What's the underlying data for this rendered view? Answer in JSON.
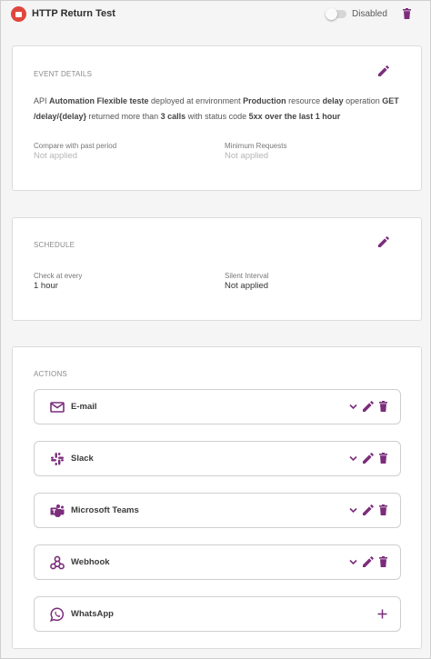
{
  "header": {
    "title": "HTTP Return Test",
    "toggle_label": "Disabled"
  },
  "event_details": {
    "section_title": "EVENT DETAILS",
    "desc": {
      "p1": "API ",
      "api_name": "Automation Flexible teste",
      "p2": " deployed at environment ",
      "environment": "Production",
      "p3": " resource ",
      "resource": "delay",
      "p4": " operation ",
      "operation": "GET /delay/{delay}",
      "p5": " returned more than ",
      "calls": "3 calls",
      "p6": " with status code ",
      "status_window": "5xx over the last 1 hour"
    },
    "compare_label": "Compare with past period",
    "compare_value": "Not applied",
    "min_requests_label": "Minimum Requests",
    "min_requests_value": "Not applied"
  },
  "schedule": {
    "section_title": "SCHEDULE",
    "check_label": "Check at every",
    "check_value": "1 hour",
    "silent_label": "Silent Interval",
    "silent_value": "Not applied"
  },
  "actions": {
    "section_title": "ACTIONS",
    "items": [
      {
        "label": "E-mail",
        "icon": "email-icon"
      },
      {
        "label": "Slack",
        "icon": "slack-icon"
      },
      {
        "label": "Microsoft Teams",
        "icon": "teams-icon"
      },
      {
        "label": "Webhook",
        "icon": "webhook-icon"
      },
      {
        "label": "WhatsApp",
        "icon": "whatsapp-icon"
      }
    ]
  },
  "colors": {
    "accent": "#7b2d7b",
    "alert": "#e0463c",
    "background": "#f5f5f6"
  }
}
